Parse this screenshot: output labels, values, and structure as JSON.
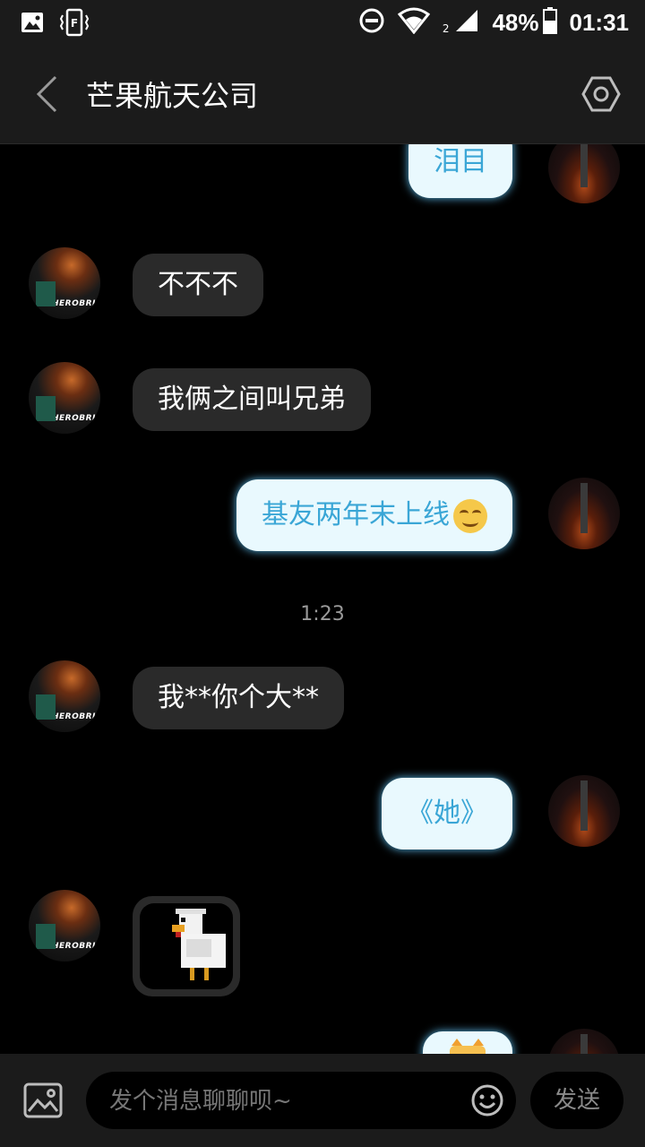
{
  "status_bar": {
    "network_sub": "2",
    "battery": "48%",
    "time": "01:31"
  },
  "header": {
    "title": "芒果航天公司"
  },
  "avatars": {
    "left_tag": "HEROBRINE"
  },
  "messages": [
    {
      "side": "right",
      "text": "泪目"
    },
    {
      "side": "left",
      "text": "不不不"
    },
    {
      "side": "left",
      "text": "我俩之间叫兄弟"
    },
    {
      "side": "right",
      "text": "基友两年末上线",
      "emoji": "grin-emoji"
    },
    {
      "side": "left",
      "text": "我**你个大**"
    },
    {
      "side": "right",
      "text": "《她》"
    },
    {
      "side": "left",
      "type": "sticker",
      "sticker": "minecraft-chicken"
    },
    {
      "side": "right",
      "type": "sticker",
      "sticker": "cat-sticker"
    }
  ],
  "timestamp": "1:23",
  "input_bar": {
    "placeholder": "发个消息聊聊呗~",
    "send_label": "发送"
  },
  "colors": {
    "bg": "#000000",
    "bar": "#1b1b1b",
    "bubble_left": "#2a2a2a",
    "bubble_right": "#e9f9fe",
    "bubble_right_text": "#3aa6d6",
    "timestamp": "#9a9a9a"
  }
}
